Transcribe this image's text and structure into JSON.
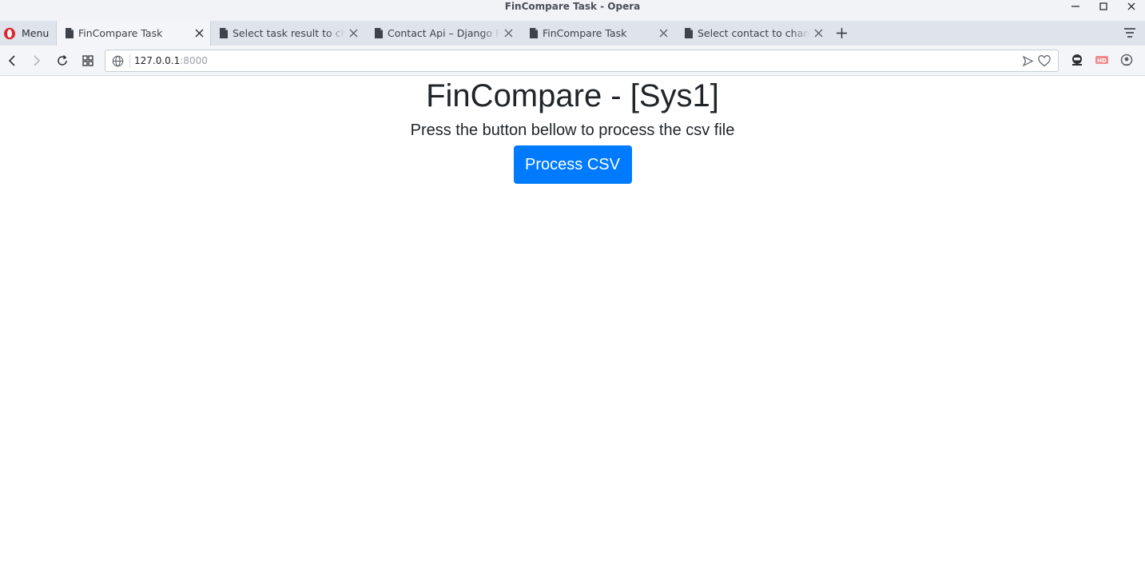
{
  "window": {
    "title": "FinCompare Task - Opera"
  },
  "browser": {
    "menu_label": "Menu",
    "tabs": [
      {
        "label": "FinCompare Task",
        "active": true
      },
      {
        "label": "Select task result to chan",
        "active": false
      },
      {
        "label": "Contact Api – Django RES",
        "active": false
      },
      {
        "label": "FinCompare Task",
        "active": false
      },
      {
        "label": "Select contact to change",
        "active": false
      }
    ],
    "address": {
      "host": "127.0.0.1",
      "port": ":8000"
    },
    "colors": {
      "opera_red": "#e0262c",
      "tabbar_bg": "#dfe3ec",
      "toolbar_bg": "#f4f5f8"
    },
    "icons": [
      "opera-logo-icon",
      "document-icon",
      "close-icon",
      "plus-icon",
      "tab-menu-icon",
      "back-icon",
      "forward-icon",
      "reload-icon",
      "speed-dial-icon",
      "globe-icon",
      "send-icon",
      "heart-icon",
      "vpn-icon",
      "hd-icon",
      "flow-icon"
    ]
  },
  "page": {
    "heading": "FinCompare - [Sys1]",
    "lead": "Press the button bellow to process the csv file",
    "button_label": "Process CSV",
    "colors": {
      "button_bg": "#007bff",
      "text": "#212529"
    }
  }
}
